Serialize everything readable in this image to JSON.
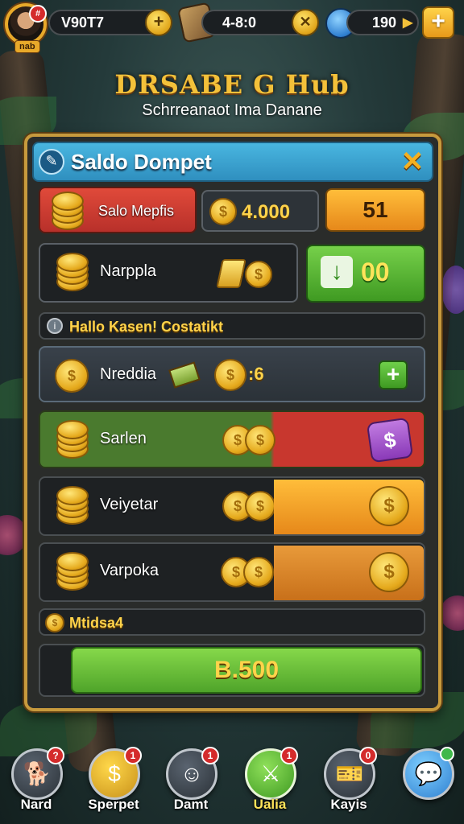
{
  "topbar": {
    "avatar_badge": "#",
    "level_tag": "nab",
    "currency1_value": "V90T7",
    "currency1_button_icon": "plus",
    "currency2_value": "4-8:0",
    "currency2_button_icon": "x",
    "currency3_value": "190",
    "add_button_label": "+"
  },
  "header": {
    "title": "DRSABE G Hub",
    "subtitle": "Schrreanaot Ima Danane"
  },
  "panel": {
    "title": "Saldo Dompet",
    "close_label": "✕",
    "row1": {
      "label": "Salo Mepfis",
      "amount": "4.000",
      "count": "51"
    },
    "row2": {
      "label": "Narppla",
      "action_value": "00"
    },
    "section1_label": "Hallo Kasen! Costatikt",
    "row3": {
      "label": "Nreddia",
      "amount": ":6",
      "action_label": "+"
    },
    "row4": {
      "label": "Sarlen"
    },
    "row5": {
      "label": "Veiyetar"
    },
    "row6": {
      "label": "Varpoka"
    },
    "section2_label": "Mtidsa4",
    "total_button_label": "B.500"
  },
  "bottom_nav": [
    {
      "label": "Nard",
      "badge": "?",
      "icon": "dog-icon"
    },
    {
      "label": "Sperpet",
      "badge": "1",
      "icon": "coin-icon"
    },
    {
      "label": "Damt",
      "badge": "1",
      "icon": "character-icon"
    },
    {
      "label": "Ualia",
      "badge": "1",
      "icon": "sword-icon"
    },
    {
      "label": "Kayis",
      "badge": "0",
      "icon": "ticket-icon"
    },
    {
      "label": "",
      "badge": "",
      "icon": "chat-icon"
    }
  ],
  "colors": {
    "accent_gold": "#f3c13a",
    "panel_header_blue": "#3fa6d4",
    "green_button": "#5fb83a",
    "red_row": "#c8372e",
    "orange_row": "#f0a020"
  }
}
